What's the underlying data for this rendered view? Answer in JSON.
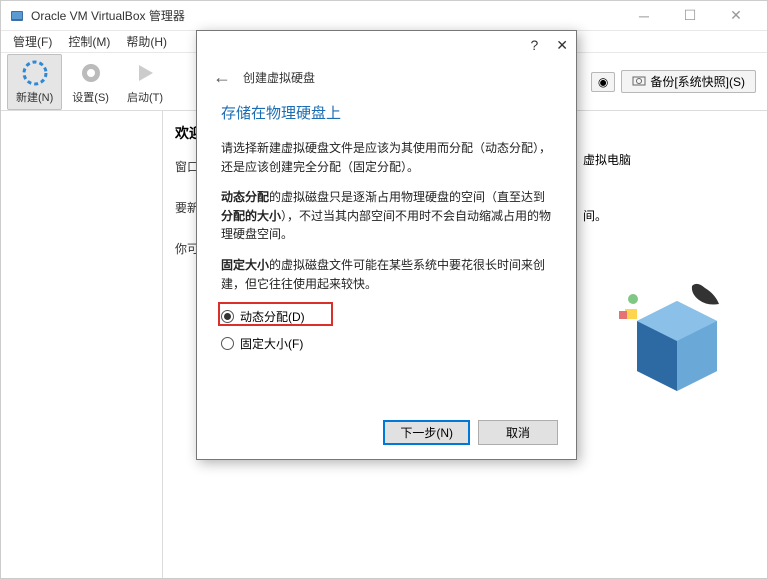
{
  "window": {
    "title": "Oracle VM VirtualBox 管理器"
  },
  "menu": {
    "manage": "管理(F)",
    "control": "控制(M)",
    "help": "帮助(H)"
  },
  "toolbar": {
    "new": "新建(N)",
    "settings": "设置(S)",
    "start": "启动(T)"
  },
  "rightbar": {
    "detail_icon": "◉",
    "snapshot": "备份[系统快照](S)"
  },
  "content": {
    "welcome": "欢迎",
    "line1": "窗口",
    "line2": "要新",
    "line3": "你可",
    "after_dialog": "虚拟电脑",
    "after_dialog2": "间。"
  },
  "dialog": {
    "header": "创建虚拟硬盘",
    "section": "存储在物理硬盘上",
    "p1": "请选择新建虚拟硬盘文件是应该为其使用而分配（动态分配），还是应该创建完全分配（固定分配）。",
    "p2a": "动态分配",
    "p2b": "的虚拟磁盘只是逐渐占用物理硬盘的空间（直至达到",
    "p2c": "分配的大小",
    "p2d": "），不过当其内部空间不用时不会自动缩减占用的物理硬盘空间。",
    "p3a": "固定大小",
    "p3b": "的虚拟磁盘文件可能在某些系统中要花很长时间来创建，但它往往使用起来较快。",
    "radio1": "动态分配(D)",
    "radio2": "固定大小(F)",
    "next": "下一步(N)",
    "cancel": "取消"
  }
}
